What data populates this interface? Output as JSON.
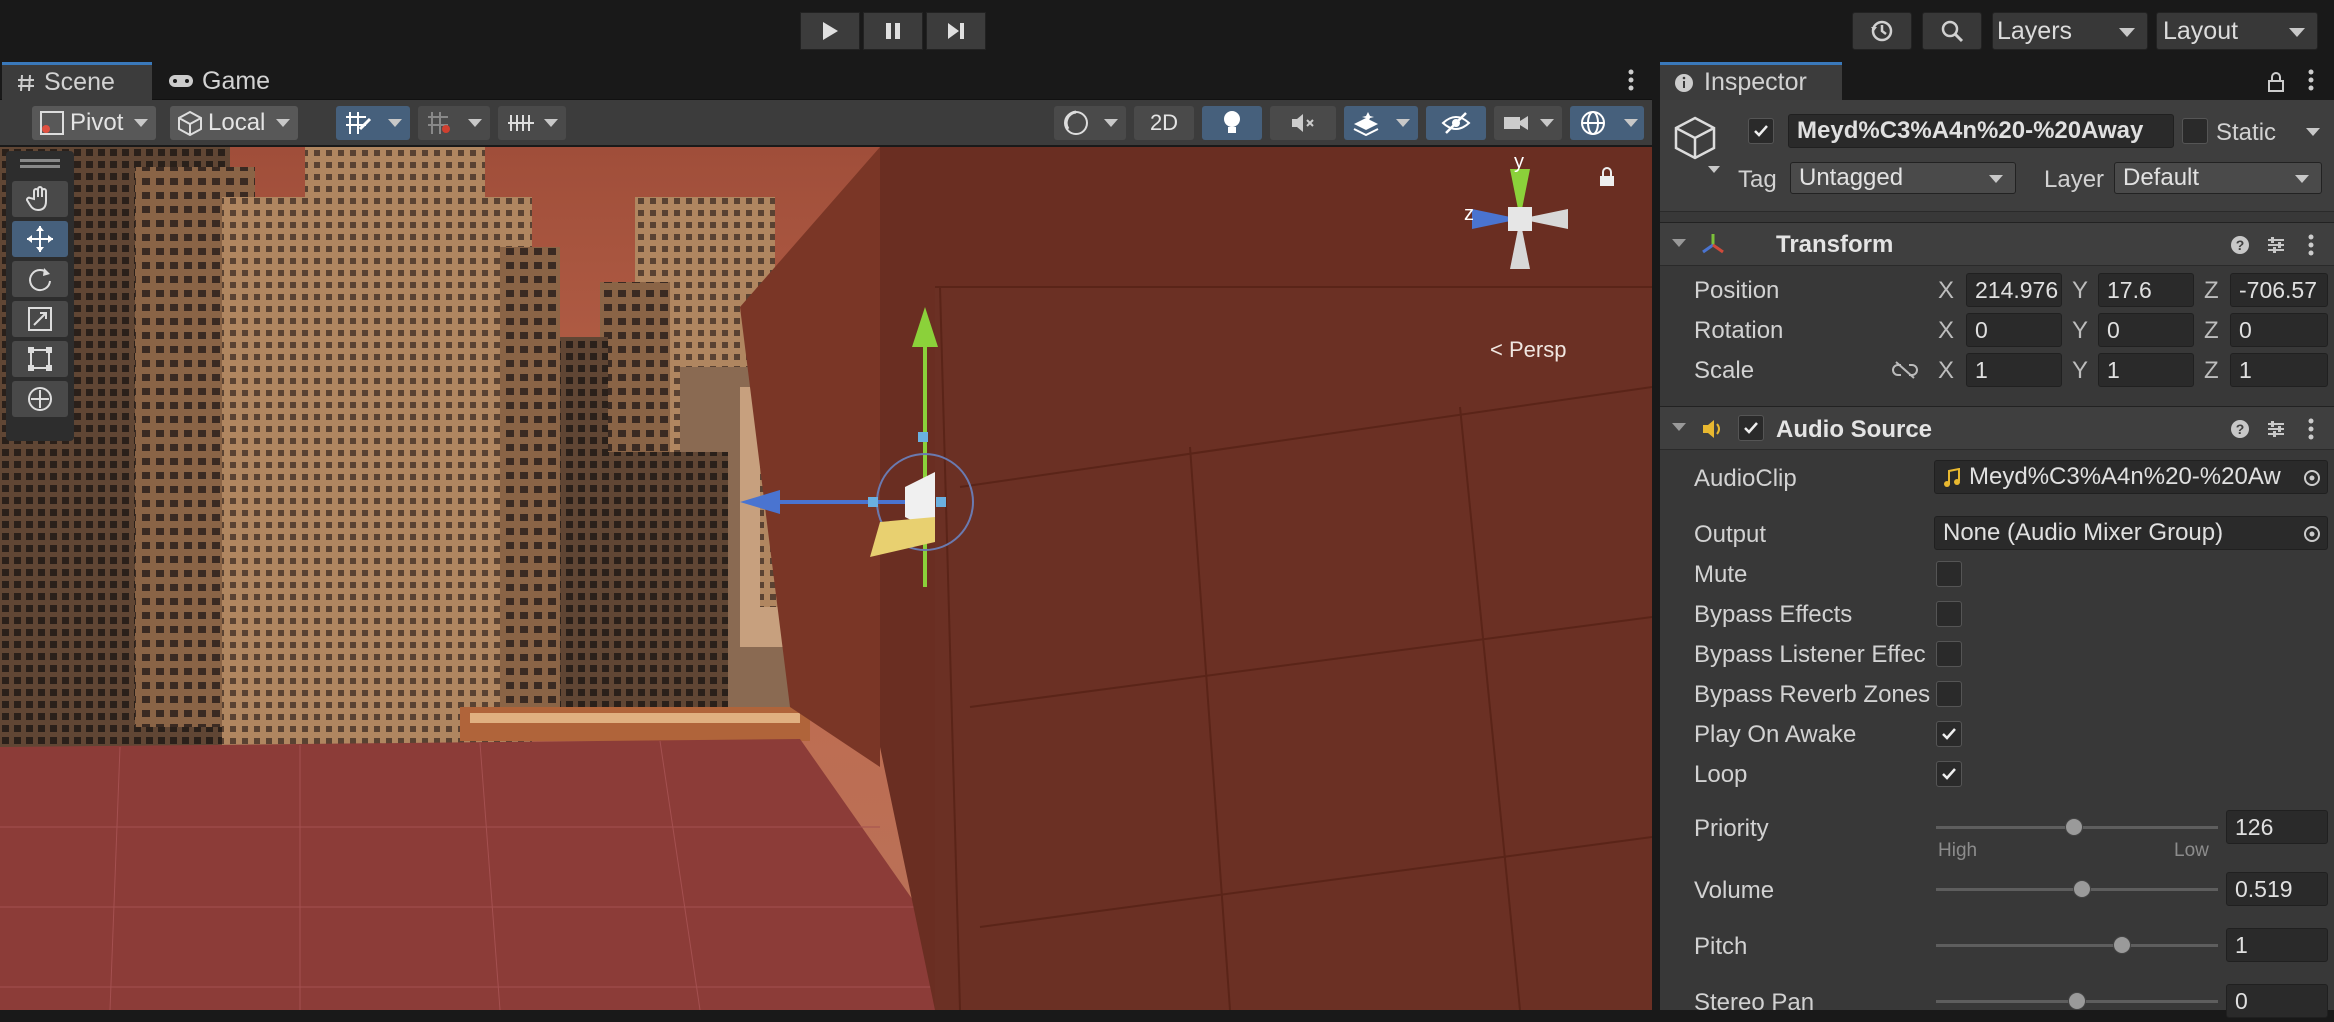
{
  "topbar": {
    "history_icon": "history-icon",
    "search_icon": "search-icon",
    "layers_label": "Layers",
    "layout_label": "Layout"
  },
  "scene_view": {
    "tabs": [
      {
        "label": "Scene",
        "icon": "hash-icon"
      },
      {
        "label": "Game",
        "icon": "gamepad-icon"
      }
    ],
    "toolbar": {
      "pivot_label": "Pivot",
      "local_label": "Local",
      "mode_2d_label": "2D"
    },
    "gizmo": {
      "y_label": "y",
      "z_label": "z",
      "persp_label": "Persp"
    },
    "tools": [
      "hand-tool-icon",
      "move-tool-icon",
      "rotate-tool-icon",
      "scale-tool-icon",
      "rect-tool-icon",
      "transform-tool-icon"
    ]
  },
  "inspector": {
    "tab_label": "Inspector",
    "object": {
      "active": true,
      "name": "Meyd%C3%A4n%20-%20Away",
      "static_label": "Static",
      "tag_label": "Tag",
      "tag_value": "Untagged",
      "layer_label": "Layer",
      "layer_value": "Default"
    },
    "transform": {
      "title": "Transform",
      "position_label": "Position",
      "rotation_label": "Rotation",
      "scale_label": "Scale",
      "position": {
        "x": "214.976",
        "y": "17.6",
        "z": "-706.57"
      },
      "rotation": {
        "x": "0",
        "y": "0",
        "z": "0"
      },
      "scale": {
        "x": "1",
        "y": "1",
        "z": "1"
      },
      "axis_x": "X",
      "axis_y": "Y",
      "axis_z": "Z"
    },
    "audio_source": {
      "title": "Audio Source",
      "enabled": true,
      "audioclip_label": "AudioClip",
      "audioclip_value": "Meyd%C3%A4n%20-%20Aw",
      "output_label": "Output",
      "output_value": "None (Audio Mixer Group)",
      "mute_label": "Mute",
      "mute": false,
      "bypass_effects_label": "Bypass Effects",
      "bypass_effects": false,
      "bypass_listener_label": "Bypass Listener Effec",
      "bypass_listener": false,
      "bypass_reverb_label": "Bypass Reverb Zones",
      "bypass_reverb": false,
      "play_on_awake_label": "Play On Awake",
      "play_on_awake": true,
      "loop_label": "Loop",
      "loop": true,
      "priority_label": "Priority",
      "priority_value": "126",
      "priority_fraction": 0.49,
      "priority_high": "High",
      "priority_low": "Low",
      "volume_label": "Volume",
      "volume_value": "0.519",
      "volume_fraction": 0.519,
      "pitch_label": "Pitch",
      "pitch_value": "1",
      "pitch_fraction": 0.66,
      "stereo_pan_label": "Stereo Pan",
      "stereo_pan_value": "0",
      "stereo_pan_fraction": 0.5
    }
  },
  "colors": {
    "selected_blue": "#46607c",
    "accent": "#3a79bb",
    "panel": "#383838",
    "sky": "#b8654a",
    "wall": "#6a2e22",
    "floor": "#8a3a34"
  }
}
